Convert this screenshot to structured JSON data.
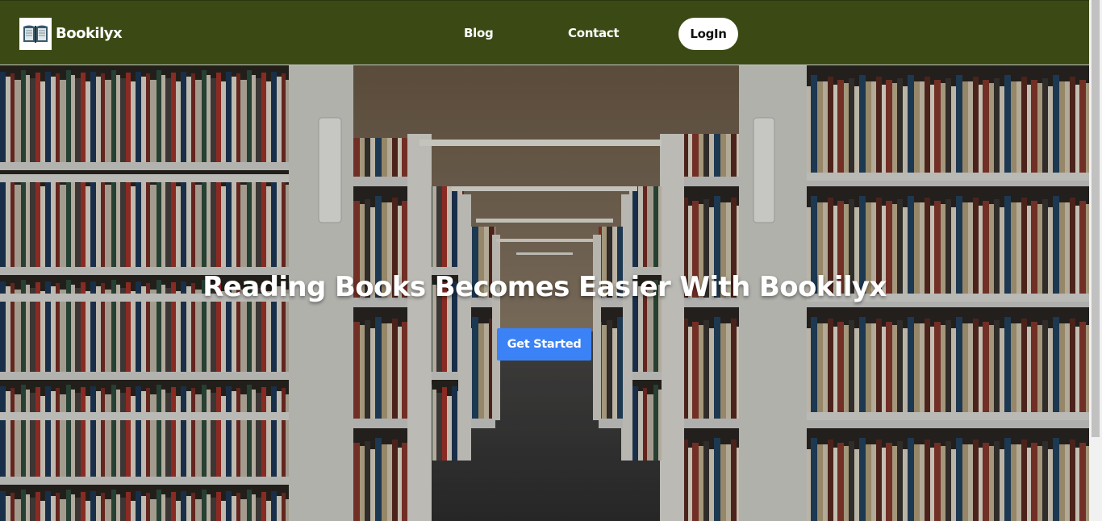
{
  "navbar": {
    "brand": "Bookilyx",
    "logo_icon": "open-book-icon",
    "links": {
      "blog": "Blog",
      "contact": "Contact"
    },
    "login_label": "LogIn",
    "background": "#3b4a14"
  },
  "hero": {
    "title": "Reading Books Becomes Easier With Bookilyx",
    "cta_label": "Get Started",
    "cta_color": "#3b82f6",
    "background_image": "library-aisle-bookshelves"
  }
}
